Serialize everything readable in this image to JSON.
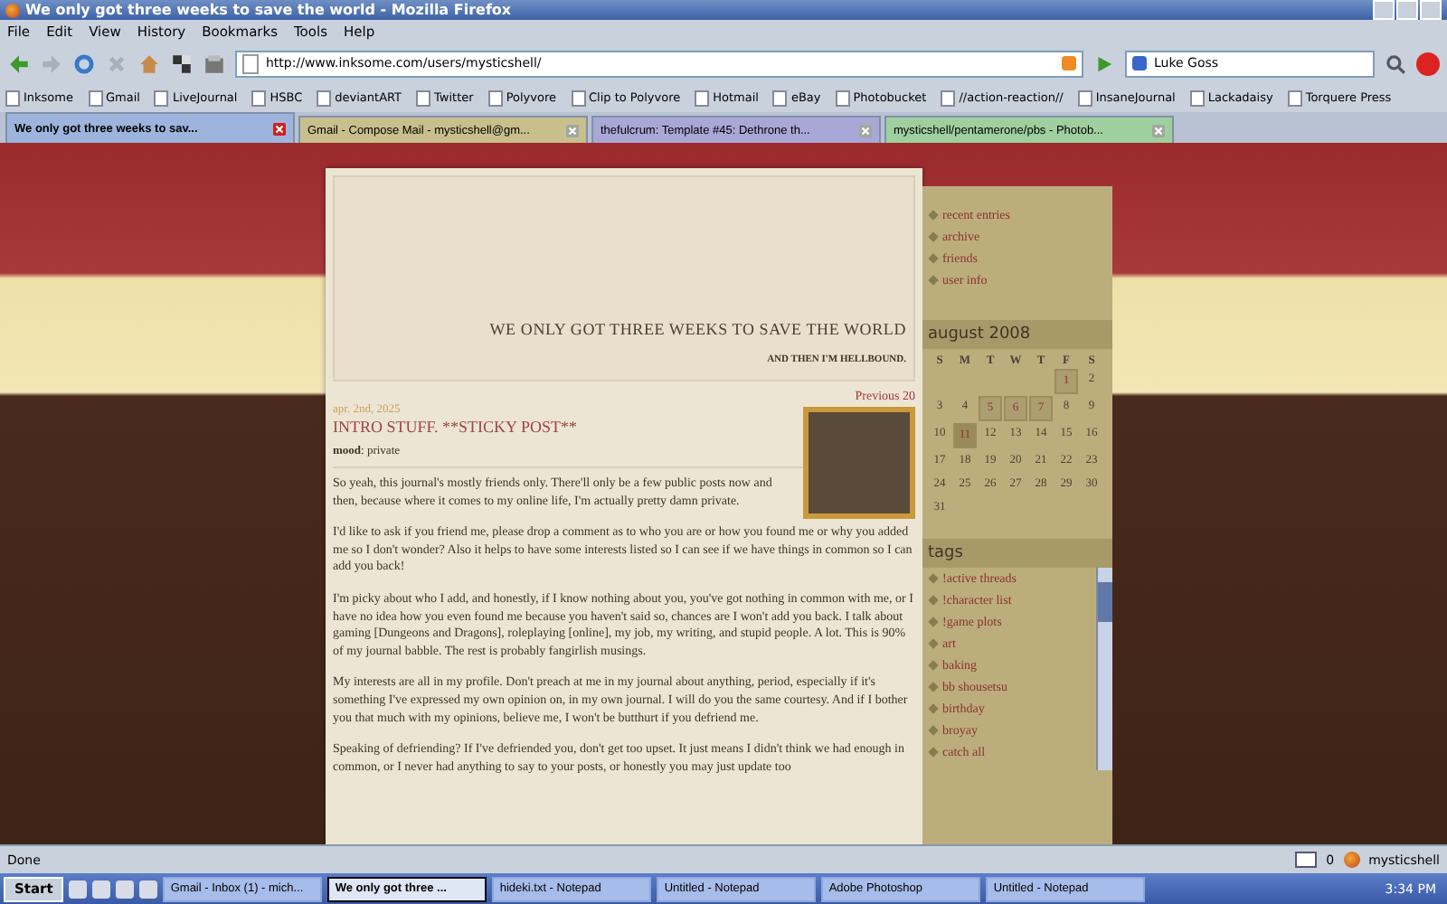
{
  "window": {
    "title": "We only got three weeks to save the world - Mozilla Firefox"
  },
  "menu": [
    "File",
    "Edit",
    "View",
    "History",
    "Bookmarks",
    "Tools",
    "Help"
  ],
  "address": {
    "value": "http://www.inksome.com/users/mysticshell/"
  },
  "search": {
    "value": "Luke Goss"
  },
  "bookmarks": [
    "Inksome",
    "Gmail",
    "LiveJournal",
    "HSBC",
    "deviantART",
    "Twitter",
    "Polyvore",
    "Clip to Polyvore",
    "Hotmail",
    "eBay",
    "Photobucket",
    "//action-reaction//",
    "InsaneJournal",
    "Lackadaisy",
    "Torquere Press"
  ],
  "tabs": [
    {
      "label": "We only got three weeks to sav...",
      "selected": true,
      "color": "#9db4dc"
    },
    {
      "label": "Gmail - Compose Mail - mysticshell@gm...",
      "selected": false,
      "color": "#c8bf8c"
    },
    {
      "label": "thefulcrum: Template #45: Dethrone th...",
      "selected": false,
      "color": "#a9a7d6"
    },
    {
      "label": "mysticshell/pentamerone/pbs - Photob...",
      "selected": false,
      "color": "#9fcf9f"
    }
  ],
  "journal": {
    "title": "WE ONLY GOT THREE WEEKS TO SAVE THE WORLD",
    "subtitle": "AND THEN I'M HELLBOUND.",
    "nav": "Previous 20"
  },
  "post": {
    "date": "apr. 2nd, 2025",
    "title": "INTRO STUFF. **STICKY POST**",
    "mood": "**mood**: private",
    "paragraphs": [
      "So yeah, this journal's mostly friends only. There'll only be a few public posts now and then, because where it comes to my online life, I'm actually pretty damn private.",
      "I'd like to ask if you friend me, please drop a comment as to who you are or how you found me or why you added me so I don't wonder? Also it helps to have some interests listed so I can see if we have things in common so I can add you back!",
      "I'm picky about who I add, and honestly, if I know nothing about you, you've got nothing in common with me, or I have no idea how you even found me because you haven't said so, chances are I won't add you back. I talk about gaming [Dungeons and Dragons], roleplaying [online], my job, my writing, and stupid people. A lot. This is 90% of my journal babble. The rest is probably fangirlish musings.",
      "My interests are all in my profile. Don't preach at me in my journal about anything, period, especially if it's something I've expressed my own opinion on, in my own journal. I will do you the same courtesy. And if I bother you that much with my opinions, believe me, I won't be butthurt if you defriend me.",
      "Speaking of defriending? If I've defriended you, don't get too upset. It just means I didn't think we had enough in common, or I never had anything to say to your posts, or honestly you may just update too"
    ]
  },
  "sidebar": {
    "links": [
      "recent entries",
      "archive",
      "friends",
      "user info"
    ],
    "calendar": {
      "title": "august 2008",
      "weekdays": [
        "S",
        "M",
        "T",
        "W",
        "T",
        "F",
        "S"
      ],
      "weeks": [
        [
          {
            "day": "1",
            "highlighted": true,
            "current": false
          },
          {
            "day": "2",
            "highlighted": false,
            "current": false
          }
        ],
        [
          {
            "day": "3",
            "highlighted": false,
            "current": false
          },
          {
            "day": "4",
            "highlighted": false,
            "current": false
          },
          {
            "day": "5",
            "highlighted": true,
            "current": false
          },
          {
            "day": "6",
            "highlighted": true,
            "current": false
          },
          {
            "day": "7",
            "highlighted": true,
            "current": false
          },
          {
            "day": "8",
            "highlighted": false,
            "current": false
          },
          {
            "day": "9",
            "highlighted": false,
            "current": false
          }
        ],
        [
          {
            "day": "10",
            "highlighted": false,
            "current": false
          },
          {
            "day": "11",
            "highlighted": true,
            "current": true
          },
          {
            "day": "12",
            "highlighted": false,
            "current": false
          },
          {
            "day": "13",
            "highlighted": false,
            "current": false
          },
          {
            "day": "14",
            "highlighted": false,
            "current": false
          },
          {
            "day": "15",
            "highlighted": false,
            "current": false
          },
          {
            "day": "16",
            "highlighted": false,
            "current": false
          }
        ],
        [
          {
            "day": "17",
            "highlighted": false,
            "current": false
          },
          {
            "day": "18",
            "highlighted": false,
            "current": false
          },
          {
            "day": "19",
            "highlighted": false,
            "current": false
          },
          {
            "day": "20",
            "highlighted": false,
            "current": false
          },
          {
            "day": "21",
            "highlighted": false,
            "current": false
          },
          {
            "day": "22",
            "highlighted": false,
            "current": false
          },
          {
            "day": "23",
            "highlighted": false,
            "current": false
          }
        ],
        [
          {
            "day": "24",
            "highlighted": false,
            "current": false
          },
          {
            "day": "25",
            "highlighted": false,
            "current": false
          },
          {
            "day": "26",
            "highlighted": false,
            "current": false
          },
          {
            "day": "27",
            "highlighted": false,
            "current": false
          },
          {
            "day": "28",
            "highlighted": false,
            "current": false
          },
          {
            "day": "29",
            "highlighted": false,
            "current": false
          },
          {
            "day": "30",
            "highlighted": false,
            "current": false
          }
        ],
        [
          {
            "day": "31",
            "highlighted": false,
            "current": false
          }
        ]
      ]
    },
    "tags_title": "tags",
    "tags": [
      "!active threads",
      "!character list",
      "!game plots",
      "art",
      "baking",
      "bb shousetsu",
      "birthday",
      "broyay",
      "catch all"
    ]
  },
  "status_bar": {
    "text": "Done",
    "mail_count": "0",
    "user": "mysticshell"
  },
  "taskbar": {
    "start": "Start",
    "items": [
      {
        "label": "Gmail - Inbox (1) - mich...",
        "selected": false
      },
      {
        "label": "We only got three ...",
        "selected": true
      },
      {
        "label": "hideki.txt - Notepad",
        "selected": false
      },
      {
        "label": "Untitled - Notepad",
        "selected": false
      },
      {
        "label": "Adobe Photoshop",
        "selected": false
      },
      {
        "label": "Untitled - Notepad",
        "selected": false
      }
    ],
    "clock": "3:34 PM"
  }
}
